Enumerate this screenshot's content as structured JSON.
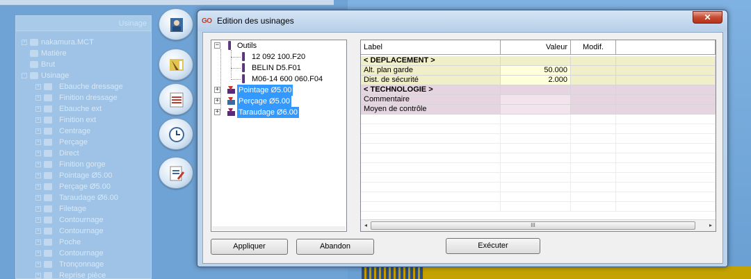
{
  "background": {
    "panel_title": "Usinage",
    "tree": [
      {
        "label": "nakamura.MCT",
        "level": 0,
        "expander": "+"
      },
      {
        "label": "Matière",
        "level": 0,
        "expander": ""
      },
      {
        "label": "Brut",
        "level": 0,
        "expander": ""
      },
      {
        "label": "Usinage",
        "level": 0,
        "expander": "-"
      },
      {
        "label": "Ebauche dressage",
        "level": 1,
        "expander": "+"
      },
      {
        "label": "Finition dressage",
        "level": 1,
        "expander": "+"
      },
      {
        "label": "Ebauche ext",
        "level": 1,
        "expander": "+"
      },
      {
        "label": "Finition ext",
        "level": 1,
        "expander": "+"
      },
      {
        "label": "Centrage",
        "level": 1,
        "expander": "+"
      },
      {
        "label": "Perçage",
        "level": 1,
        "expander": "+"
      },
      {
        "label": "Direct",
        "level": 1,
        "expander": "+"
      },
      {
        "label": "Finition gorge",
        "level": 1,
        "expander": "+"
      },
      {
        "label": "Pointage Ø5.00",
        "level": 1,
        "expander": "+"
      },
      {
        "label": "Perçage Ø5.00",
        "level": 1,
        "expander": "+"
      },
      {
        "label": "Taraudage Ø6.00",
        "level": 1,
        "expander": "+"
      },
      {
        "label": "Filetage",
        "level": 1,
        "expander": "+"
      },
      {
        "label": "Contournage",
        "level": 1,
        "expander": "+"
      },
      {
        "label": "Contournage",
        "level": 1,
        "expander": "+"
      },
      {
        "label": "Poche",
        "level": 1,
        "expander": "+"
      },
      {
        "label": "Contournage",
        "level": 1,
        "expander": "+"
      },
      {
        "label": "Tronçonnage",
        "level": 1,
        "expander": "+"
      },
      {
        "label": "Reprise pièce",
        "level": 1,
        "expander": "+"
      }
    ],
    "side_buttons": [
      "operator-icon",
      "tool-icon",
      "program-list-icon",
      "clock-icon",
      "edit-doc-icon"
    ]
  },
  "dialog": {
    "app_badge": "GO",
    "title": "Edition des usinages",
    "close_glyph": "✕",
    "tree": {
      "root": {
        "label": "Outils",
        "expander": "−"
      },
      "tools": [
        "12 092 100.F20",
        "BELIN D5.F01",
        "M06-14 600 060.F04"
      ],
      "operations": [
        {
          "label": "Pointage Ø5.00",
          "expander": "+"
        },
        {
          "label": "Perçage Ø5.00",
          "expander": "+"
        },
        {
          "label": "Taraudage Ø6.00",
          "expander": "+"
        }
      ]
    },
    "grid": {
      "columns": [
        "Label",
        "Valeur",
        "Modif."
      ],
      "rows": [
        {
          "label": "< DEPLACEMENT >",
          "value": "",
          "modif": "",
          "style": "yellow",
          "bold": true
        },
        {
          "label": "Alt. plan garde",
          "value": "50.000",
          "modif": "",
          "style": "yellow",
          "bold": false
        },
        {
          "label": "Dist. de sécurité",
          "value": "2.000",
          "modif": "",
          "style": "yellow",
          "bold": false
        },
        {
          "label": "< TECHNOLOGIE >",
          "value": "",
          "modif": "",
          "style": "pink",
          "bold": true
        },
        {
          "label": "Commentaire",
          "value": "",
          "modif": "",
          "style": "pink",
          "bold": false
        },
        {
          "label": "Moyen de contrôle",
          "value": "",
          "modif": "",
          "style": "pink",
          "bold": false
        }
      ],
      "scroll_left": "◂",
      "scroll_right": "▸",
      "scroll_grip": "III"
    },
    "buttons": {
      "apply": "Appliquer",
      "cancel": "Abandon",
      "execute": "Exécuter"
    }
  }
}
